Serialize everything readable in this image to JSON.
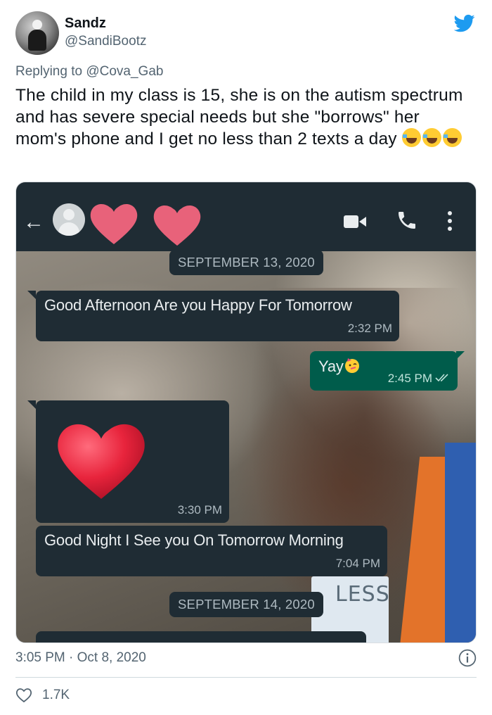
{
  "tweet": {
    "author_name": "Sandz",
    "author_handle": "@SandiBootz",
    "reply_prefix": "Replying to",
    "reply_handle": "@Cova_Gab",
    "text": "The child in my class is 15, she is on the autism spectrum and has severe special needs but she \"borrows\" her mom's phone and I get no less than 2 texts a day",
    "text_emoji": "face-with-tears-of-joy x3",
    "timestamp": "3:05 PM · Oct 8, 2020",
    "like_count": "1.7K",
    "brand_color": "#1d9bf0"
  },
  "screenshot": {
    "icons": [
      "back-arrow-icon",
      "contact-avatar-icon",
      "video-call-icon",
      "phone-call-icon",
      "more-options-icon"
    ],
    "dates": [
      "SEPTEMBER 13, 2020",
      "SEPTEMBER 14, 2020"
    ],
    "messages": [
      {
        "direction": "in",
        "text": "Good Afternoon Are you Happy For Tomorrow",
        "time": "2:32 PM"
      },
      {
        "direction": "out",
        "text": "Yay",
        "emoji": "partying-face",
        "time": "2:45 PM",
        "status": "read"
      },
      {
        "direction": "in",
        "emoji": "red-heart",
        "time": "3:30 PM"
      },
      {
        "direction": "in",
        "text": "Good Night I See you On Tomorrow Morning",
        "time": "7:04 PM"
      }
    ],
    "background_text": "LESS",
    "colors": {
      "header": "#1f2c34",
      "incoming": "#1f2c34",
      "outgoing": "#005c4b",
      "heart": "#e8243c"
    }
  }
}
